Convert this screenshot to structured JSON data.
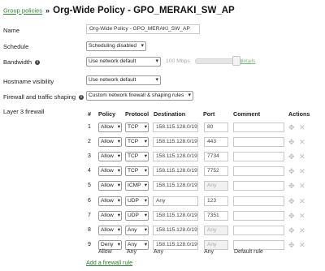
{
  "header": {
    "breadcrumb": "Group policies",
    "separator": "»",
    "title": "Org-Wide Policy - GPO_MERAKI_SW_AP"
  },
  "form": {
    "name_label": "Name",
    "name_value": "Org-Wide Policy - GPO_MERAKI_SW_AP",
    "schedule_label": "Schedule",
    "schedule_value": "Scheduling disabled",
    "bandwidth_label": "Bandwidth",
    "bandwidth_value": "Use network default",
    "bandwidth_speed": "100 Mbps",
    "bandwidth_details": "details",
    "hostname_label": "Hostname visibility",
    "hostname_value": "Use network default",
    "firewall_label": "Firewall and traffic shaping",
    "firewall_value": "Custom network firewall & shaping rules",
    "l3_label": "Layer 3 firewall"
  },
  "icons": {
    "info": "info-icon",
    "caret": "▾",
    "move": "✥",
    "delete": "✕"
  },
  "table": {
    "headers": {
      "num": "#",
      "policy": "Policy",
      "protocol": "Protocol",
      "destination": "Destination",
      "port": "Port",
      "comment": "Comment",
      "actions": "Actions"
    },
    "rows": [
      {
        "num": "1",
        "policy": "Allow",
        "protocol": "TCP",
        "destination": "158.115.128.0/19",
        "port": "80"
      },
      {
        "num": "2",
        "policy": "Allow",
        "protocol": "TCP",
        "destination": "158.115.128.0/19",
        "port": "443"
      },
      {
        "num": "3",
        "policy": "Allow",
        "protocol": "TCP",
        "destination": "158.115.128.0/19",
        "port": "7734"
      },
      {
        "num": "4",
        "policy": "Allow",
        "protocol": "TCP",
        "destination": "158.115.128.0/19",
        "port": "7752"
      },
      {
        "num": "5",
        "policy": "Allow",
        "protocol": "ICMP",
        "destination": "158.115.128.0/19",
        "port": "Any"
      },
      {
        "num": "6",
        "policy": "Allow",
        "protocol": "UDP",
        "destination": "Any",
        "port": "123"
      },
      {
        "num": "7",
        "policy": "Allow",
        "protocol": "UDP",
        "destination": "158.115.128.0/19",
        "port": "7351"
      },
      {
        "num": "8",
        "policy": "Allow",
        "protocol": "Any",
        "destination": "158.115.128.0/19",
        "port": "Any"
      },
      {
        "num": "9",
        "policy": "Deny",
        "protocol": "Any",
        "destination": "158.115.128.0/19",
        "port": "Any"
      }
    ],
    "footer": {
      "policy": "Allow",
      "protocol": "Any",
      "destination": "Any",
      "port": "Any",
      "comment": "Default rule"
    },
    "add_rule": "Add a firewall rule"
  }
}
